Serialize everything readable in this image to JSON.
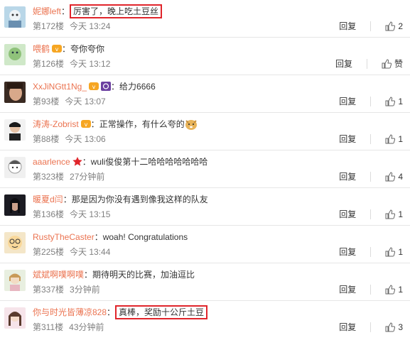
{
  "comments": [
    {
      "user": "妮娜left",
      "text": "厉害了，晚上吃土豆丝",
      "floor": "第172楼",
      "time": "今天 13:24",
      "reply": "回复",
      "likes": "2",
      "highlight": true
    },
    {
      "user": "喂鹤",
      "text": "夸你夸你",
      "floor": "第126楼",
      "time": "今天 13:12",
      "reply": "回复",
      "likes": "赞",
      "highlight": false
    },
    {
      "user": "XxJiNGtt1Ng_",
      "text": "给力6666",
      "floor": "第93楼",
      "time": "今天 13:07",
      "reply": "回复",
      "likes": "1",
      "highlight": false
    },
    {
      "user": "涛涛-Zobrist",
      "text": "正常操作，有什么夸的",
      "floor": "第88楼",
      "time": "今天 13:06",
      "reply": "回复",
      "likes": "1",
      "highlight": false
    },
    {
      "user": "aaarlence",
      "text": "wuli俊俊第十二哈哈哈哈哈哈哈",
      "floor": "第323楼",
      "time": "27分钟前",
      "reply": "回复",
      "likes": "4",
      "highlight": false
    },
    {
      "user": "暖夏d闫",
      "text": "那是因为你没有遇到像我这样的队友",
      "floor": "第136楼",
      "time": "今天 13:15",
      "reply": "回复",
      "likes": "1",
      "highlight": false
    },
    {
      "user": "RustyTheCaster",
      "text": "woah! Congratulations",
      "floor": "第225楼",
      "time": "今天 13:44",
      "reply": "回复",
      "likes": "1",
      "highlight": false
    },
    {
      "user": "斌斌啊噗啊噗",
      "text": "期待明天的比赛，加油逗比",
      "floor": "第337楼",
      "time": "3分钟前",
      "reply": "回复",
      "likes": "1",
      "highlight": false
    },
    {
      "user": "你与时光皆薄凉828",
      "text": "真棒，奖励十公斤土豆",
      "floor": "第311楼",
      "time": "43分钟前",
      "reply": "回复",
      "likes": "3",
      "highlight": true
    }
  ],
  "colors": {
    "username": "#eb7350",
    "meta": "#808080",
    "highlight_box": "#e0252b"
  }
}
